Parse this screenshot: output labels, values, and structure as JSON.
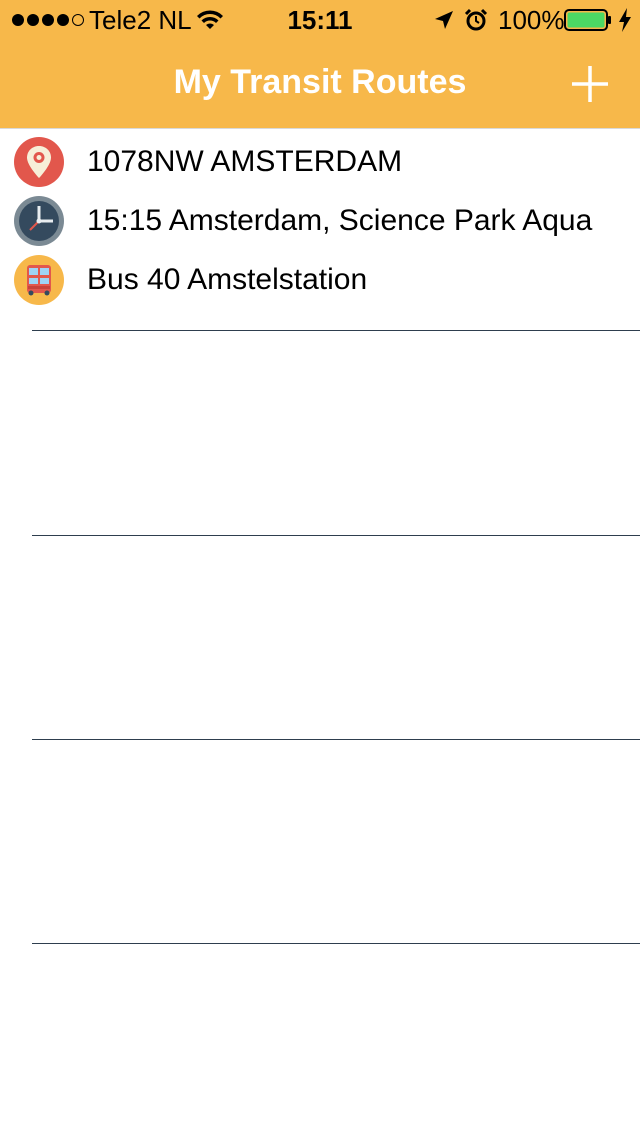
{
  "status_bar": {
    "carrier": "Tele2 NL",
    "time": "15:11",
    "battery": "100%",
    "signal_strength": 4,
    "signal_max": 5,
    "icons": [
      "signal-dots-icon",
      "wifi-icon",
      "location-arrow-icon",
      "alarm-clock-icon",
      "battery-icon",
      "charging-bolt-icon"
    ],
    "battery_color": "#4cd964"
  },
  "nav": {
    "title": "My Transit Routes",
    "add_icon": "plus-icon",
    "background_color": "#f7b84a"
  },
  "routes": [
    {
      "items": [
        {
          "icon": "location-pin-icon",
          "label": "1078NW AMSTERDAM"
        },
        {
          "icon": "clock-icon",
          "label": "15:15 Amsterdam, Science Park Aqua"
        },
        {
          "icon": "bus-icon",
          "label": "Bus 40 Amstelstation"
        }
      ]
    }
  ]
}
